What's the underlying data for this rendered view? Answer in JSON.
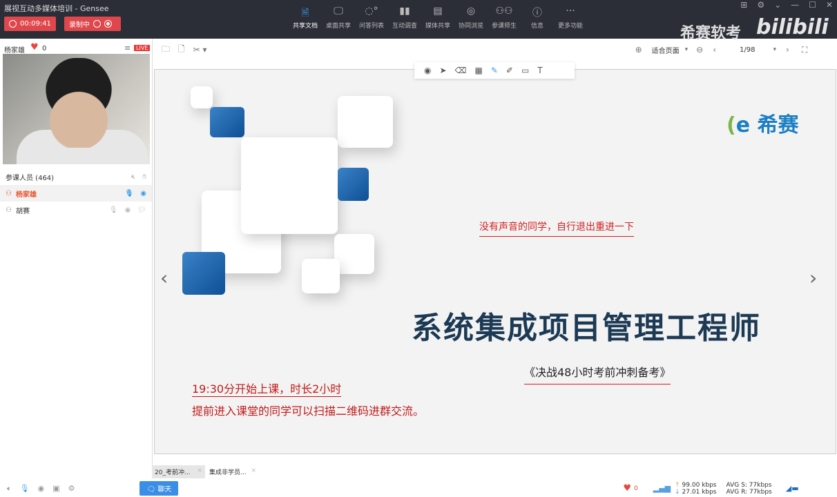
{
  "window": {
    "title": "展视互动多媒体培训  - Gensee",
    "timer": "00:09:41",
    "recording": "录制中"
  },
  "toolbar": [
    {
      "label": "共享文档",
      "icon": "document-icon"
    },
    {
      "label": "桌面共享",
      "icon": "desktop-icon"
    },
    {
      "label": "问答列表",
      "icon": "qa-icon"
    },
    {
      "label": "互动调查",
      "icon": "chart-icon"
    },
    {
      "label": "媒体共享",
      "icon": "media-icon"
    },
    {
      "label": "协同浏览",
      "icon": "browser-icon"
    },
    {
      "label": "参课师生",
      "icon": "people-icon"
    },
    {
      "label": "信息",
      "icon": "info-icon"
    },
    {
      "label": "更多功能",
      "icon": "more-icon"
    }
  ],
  "watermark": {
    "text": "希赛软考",
    "logo": "bilibili"
  },
  "user": {
    "name": "杨家雄",
    "likes": "0",
    "live": "LIVE"
  },
  "participants": {
    "header": "参课人员 (464)",
    "list": [
      {
        "name": "杨家雄"
      },
      {
        "name": "胡赛"
      }
    ]
  },
  "docbar": {
    "zoom": "适合页面",
    "page": "1/98"
  },
  "slide": {
    "logo": "希赛",
    "notice": "没有声音的同学，自行退出重进一下",
    "title": "系统集成项目管理工程师",
    "subtitle": "《决战48小时考前冲刺备考》",
    "time": "19:30分开始上课，时长2小时",
    "tip": "提前进入课堂的同学可以扫描二维码进群交流。"
  },
  "doctabs": [
    "20_考前冲...",
    "集成非学员..."
  ],
  "bottom": {
    "chat": "聊天",
    "likes": "0",
    "up": "99.00 kbps",
    "down": "27.01 kbps",
    "avg_s": "AVG S: 77kbps",
    "avg_r": "AVG R: 77kbps"
  }
}
